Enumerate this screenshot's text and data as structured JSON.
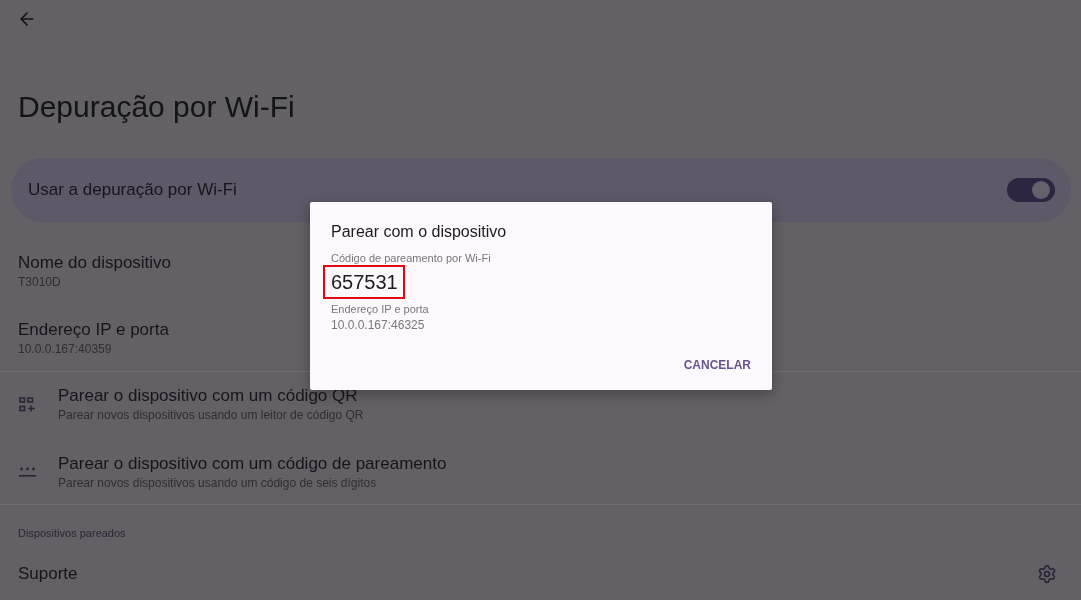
{
  "app_bar": {
    "title": "Depuração por Wi-Fi"
  },
  "main_switch": {
    "label": "Usar a depuração por Wi-Fi",
    "on": true
  },
  "info_items": [
    {
      "title": "Nome do dispositivo",
      "value": "T3010D"
    },
    {
      "title": "Endereço IP e porta",
      "value": "10.0.0.167:40359"
    }
  ],
  "pairing_options": [
    {
      "kind": "qr",
      "title": "Parear o dispositivo com um código QR",
      "subtitle": "Parear novos dispositivos usando um leitor de código QR"
    },
    {
      "kind": "code",
      "title": "Parear o dispositivo com um código de pareamento",
      "subtitle": "Parear novos dispositivos usando um código de seis dígitos"
    }
  ],
  "paired_devices": {
    "header": "Dispositivos pareados",
    "items": [
      {
        "name": "Suporte"
      }
    ]
  },
  "dialog": {
    "title": "Parear com o dispositivo",
    "code_label": "Código de pareamento por Wi-Fi",
    "code": "657531",
    "code_highlighted": true,
    "address_label": "Endereço IP e porta",
    "address": "10.0.0.167:46325",
    "buttons": [
      "CANCELAR"
    ]
  }
}
